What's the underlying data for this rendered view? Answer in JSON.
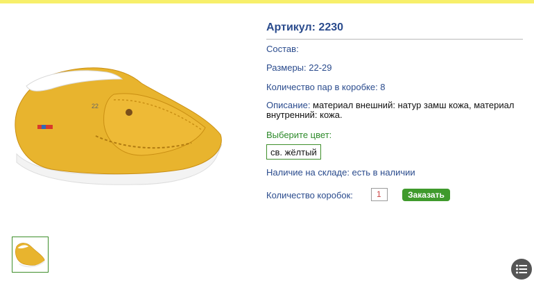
{
  "product": {
    "article": "Артикул: 2230",
    "composition_label": "Состав:",
    "sizes": "Размеры: 22-29",
    "pairs_per_box": "Количество пар в коробке: 8",
    "description_label": "Описание:",
    "description_text": " материал внешний: натур замш кожа, материал внутренний: кожа.",
    "choose_color_label": "Выберите цвет:",
    "color_option": "св. жёлтый",
    "stock": "Наличие на складе: есть в наличии",
    "boxes_label": "Количество коробок:",
    "boxes_value": "1",
    "order_button": "Заказать"
  },
  "colors": {
    "accent_blue": "#2a4b8d",
    "accent_green": "#3f9a2c",
    "top_bar": "#f7ef6a",
    "shoe": "#e8b42e"
  },
  "icons": {
    "menu_fab": "list-icon"
  }
}
